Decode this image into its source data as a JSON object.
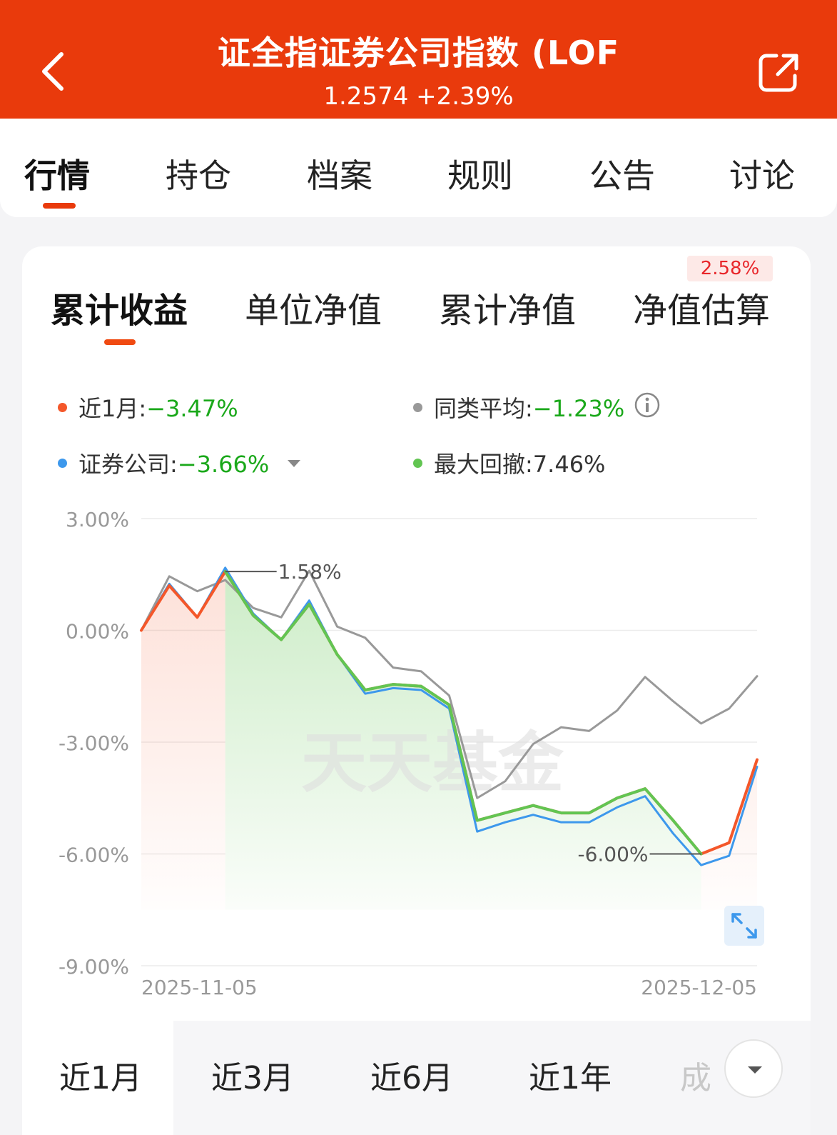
{
  "header": {
    "title": "证全指证券公司指数 (LOF",
    "price_change": "1.2574 +2.39%"
  },
  "tabs": [
    "行情",
    "持仓",
    "档案",
    "规则",
    "公告",
    "讨论"
  ],
  "sub_tabs": [
    "累计收益",
    "单位净值",
    "累计净值",
    "净值估算"
  ],
  "estimate_badge": "2.58%",
  "legend": {
    "fund_label": "近1月:",
    "fund_value": "−3.47%",
    "category_label": "同类平均:",
    "category_value": "−1.23%",
    "index_label": "证券公司:",
    "index_value": "−3.66%",
    "drawdown_label": "最大回撤:",
    "drawdown_value": "7.46%"
  },
  "colors": {
    "header_bg": "#e93a0c",
    "fund": "#f4572a",
    "category": "#999999",
    "index": "#3d98ec",
    "drawdown": "#62c552",
    "negative": "#1aa81a",
    "badge_text": "#e8262a"
  },
  "chart_data": {
    "type": "line",
    "y_ticks": [
      "3.00%",
      "0.00%",
      "-3.00%",
      "-6.00%",
      "-9.00%"
    ],
    "ylim": [
      -9,
      3
    ],
    "x_labels": [
      "2025-11-05",
      "2025-12-05"
    ],
    "watermark": "天天基金",
    "annotations": [
      {
        "text": "1.58%",
        "x_index": 3,
        "y": 1.58
      },
      {
        "text": "-6.00%",
        "x_index": 20,
        "y": -6.0
      }
    ],
    "drawdown_range": {
      "start_index": 3,
      "end_index": 20
    },
    "series": [
      {
        "name": "近1月",
        "key": "fund",
        "values": [
          0.0,
          1.2,
          0.35,
          1.58,
          0.4,
          -0.25,
          0.7,
          -0.65,
          -1.6,
          -1.45,
          -1.5,
          -2.0,
          -5.1,
          -4.9,
          -4.7,
          -4.9,
          -4.9,
          -4.5,
          -4.25,
          -5.1,
          -6.0,
          -5.7,
          -3.47
        ]
      },
      {
        "name": "证券公司",
        "key": "index",
        "values": [
          0.0,
          1.25,
          0.35,
          1.68,
          0.45,
          -0.25,
          0.8,
          -0.65,
          -1.7,
          -1.55,
          -1.6,
          -2.1,
          -5.4,
          -5.15,
          -4.95,
          -5.15,
          -5.15,
          -4.75,
          -4.45,
          -5.45,
          -6.3,
          -6.05,
          -3.66
        ]
      },
      {
        "name": "同类平均",
        "key": "category",
        "values": [
          0.0,
          1.45,
          1.05,
          1.35,
          0.6,
          0.35,
          1.6,
          0.1,
          -0.2,
          -1.0,
          -1.1,
          -1.75,
          -4.5,
          -4.05,
          -3.05,
          -2.6,
          -2.7,
          -2.15,
          -1.25,
          -1.9,
          -2.5,
          -2.1,
          -1.23
        ]
      }
    ]
  },
  "ranges": [
    "近1月",
    "近3月",
    "近6月",
    "近1年",
    "成"
  ]
}
